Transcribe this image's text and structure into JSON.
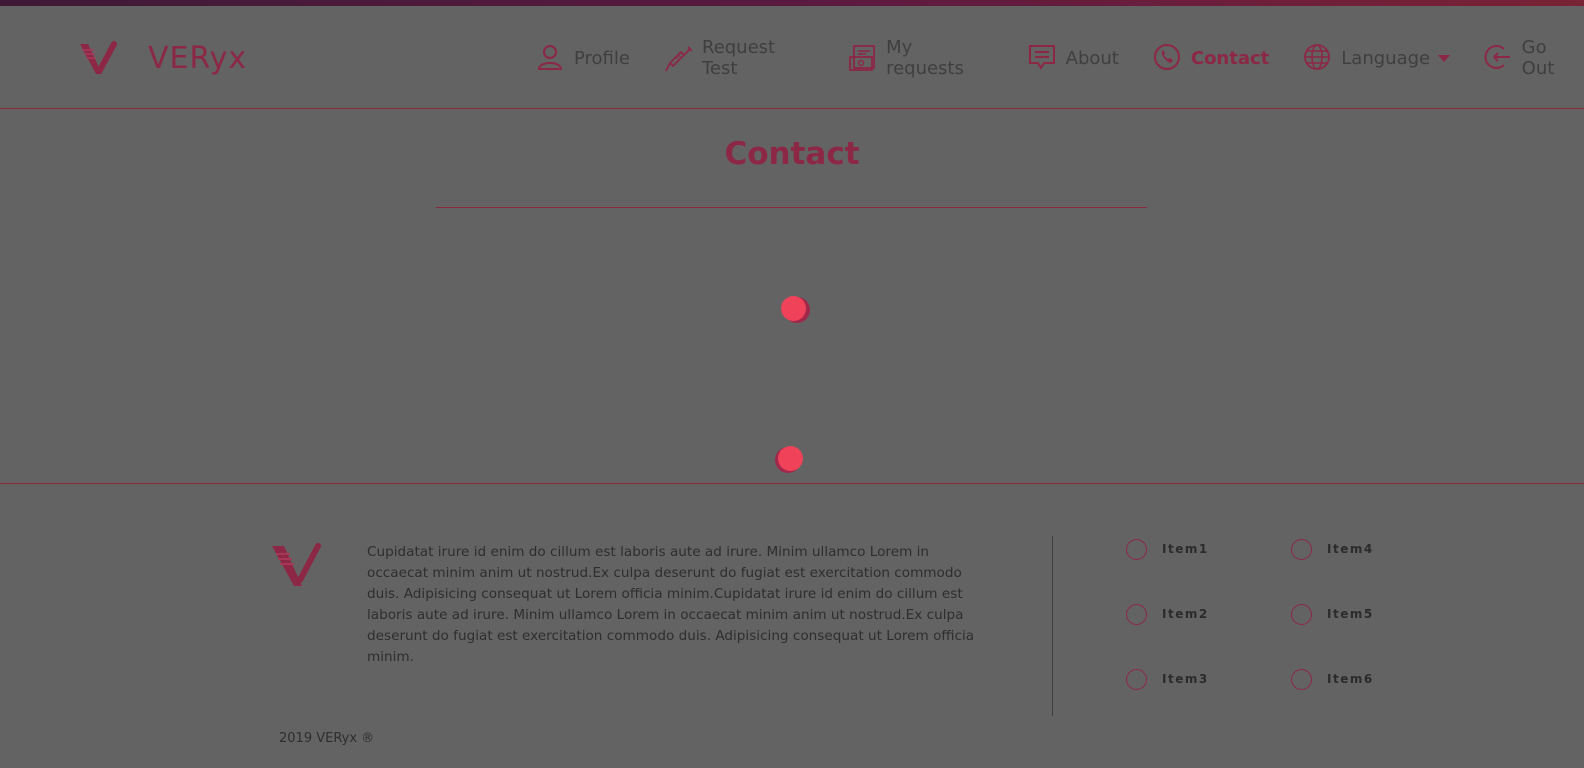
{
  "brand": {
    "name": "VERyx"
  },
  "nav": {
    "items": [
      {
        "label": "Profile",
        "icon": "user-icon"
      },
      {
        "label": "Request Test",
        "icon": "syringe-icon"
      },
      {
        "label": "My requests",
        "icon": "document-icon"
      },
      {
        "label": "About",
        "icon": "chat-icon"
      },
      {
        "label": "Contact",
        "icon": "phone-icon",
        "active": true
      },
      {
        "label": "Language",
        "icon": "globe-icon"
      },
      {
        "label": "Go Out",
        "icon": "logout-icon"
      }
    ]
  },
  "page": {
    "title": "Contact"
  },
  "footer": {
    "text": "Cupidatat irure id enim do cillum est laboris aute ad irure. Minim ullamco Lorem in occaecat minim anim ut nostrud.Ex culpa deserunt do fugiat est exercitation commodo duis. Adipisicing consequat ut Lorem officia minim.Cupidatat irure id enim do cillum est laboris aute ad irure. Minim ullamco Lorem in occaecat minim anim ut nostrud.Ex culpa deserunt do fugiat est exercitation commodo duis. Adipisicing consequat ut Lorem officia minim.",
    "links": [
      "Item1",
      "Item4",
      "Item2",
      "Item5",
      "Item3",
      "Item6"
    ],
    "copyright": "2019 VERyx ®"
  },
  "colors": {
    "accent": "#8c2746",
    "loader": "#f0435a",
    "overlay_bg": "#636363"
  }
}
